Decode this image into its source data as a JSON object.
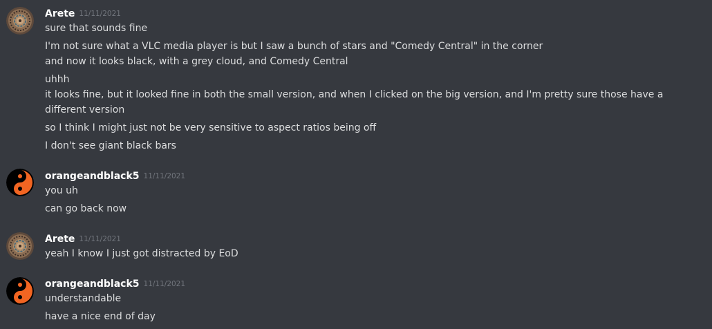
{
  "colors": {
    "background": "#36393f",
    "username": "#ffffff",
    "timestamp": "#72767d",
    "message_text": "#dcddde"
  },
  "groups": [
    {
      "author": "Arete",
      "timestamp": "11/11/2021",
      "avatar_icon": "mandala-avatar-icon",
      "messages": [
        "sure that sounds fine",
        "I'm not sure what a VLC media player is but I saw a bunch of stars and \"Comedy Central\" in the corner",
        "and now it looks black, with a grey cloud, and Comedy Central",
        "uhhh",
        "it looks fine, but it looked fine in both the small version, and when I clicked on the big version, and I'm pretty sure those have a different version",
        "so I think I might just not be very sensitive to aspect ratios being off",
        "I don't see giant black bars"
      ]
    },
    {
      "author": "orangeandblack5",
      "timestamp": "11/11/2021",
      "avatar_icon": "yin-yang-avatar-icon",
      "messages": [
        "you uh",
        "can go back now"
      ]
    },
    {
      "author": "Arete",
      "timestamp": "11/11/2021",
      "avatar_icon": "mandala-avatar-icon",
      "messages": [
        "yeah I know I just got distracted by EoD"
      ]
    },
    {
      "author": "orangeandblack5",
      "timestamp": "11/11/2021",
      "avatar_icon": "yin-yang-avatar-icon",
      "messages": [
        "understandable",
        "have a nice end of day"
      ]
    }
  ]
}
